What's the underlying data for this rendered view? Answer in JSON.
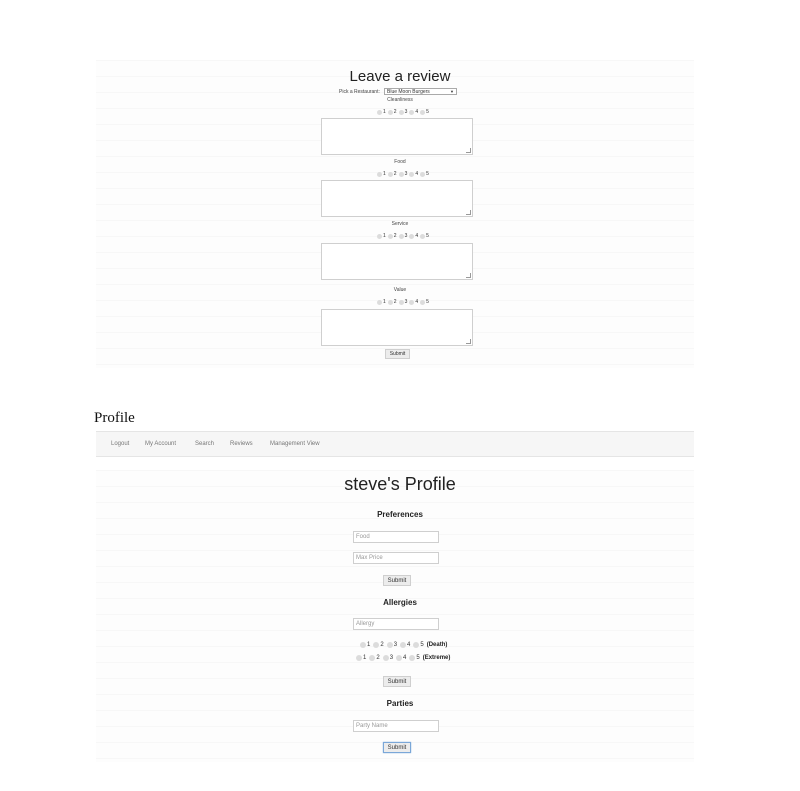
{
  "review": {
    "title": "Leave a review",
    "restaurant_label": "Pick a Restaurant:",
    "restaurant_value": "Blue Moon Burgers",
    "categories": [
      {
        "label": "Cleanliness",
        "options": [
          "1",
          "2",
          "3",
          "4",
          "5"
        ]
      },
      {
        "label": "Food",
        "options": [
          "1",
          "2",
          "3",
          "4",
          "5"
        ]
      },
      {
        "label": "Service",
        "options": [
          "1",
          "2",
          "3",
          "4",
          "5"
        ]
      },
      {
        "label": "Value",
        "options": [
          "1",
          "2",
          "3",
          "4",
          "5"
        ]
      }
    ],
    "submit_label": "Submit"
  },
  "page_heading": "Profile",
  "nav": {
    "items": [
      "Logout",
      "My Account",
      "Search",
      "Reviews",
      "Management View"
    ]
  },
  "profile": {
    "title": "steve's Profile",
    "preferences": {
      "heading": "Preferences",
      "food_placeholder": "Food",
      "max_price_placeholder": "Max Price",
      "submit_label": "Submit"
    },
    "allergies": {
      "heading": "Allergies",
      "allergy_placeholder": "Allergy",
      "scale1": {
        "options": [
          "1",
          "2",
          "3",
          "4",
          "5"
        ],
        "suffix": "(Death)"
      },
      "scale2": {
        "options": [
          "1",
          "2",
          "3",
          "4",
          "5"
        ],
        "suffix": "(Extreme)"
      },
      "submit_label": "Submit"
    },
    "parties": {
      "heading": "Parties",
      "party_placeholder": "Party Name",
      "submit_label": "Submit"
    }
  }
}
